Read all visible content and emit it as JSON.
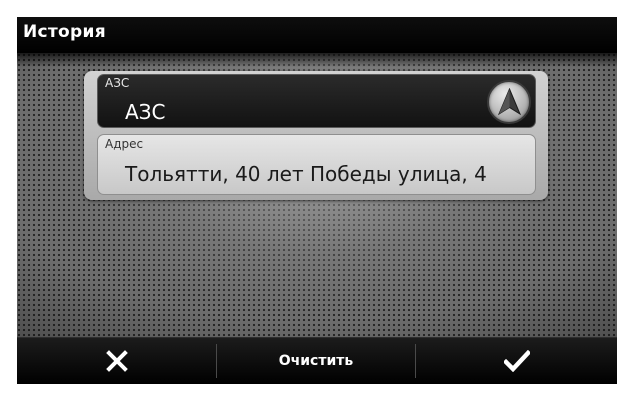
{
  "header": {
    "title": "История"
  },
  "name_field": {
    "label": "АЗС",
    "value": "АЗС"
  },
  "address_field": {
    "label": "Адрес",
    "value": "Тольятти, 40 лет Победы улица, 4"
  },
  "navigate_button": {
    "icon": "navigation-arrow-icon"
  },
  "footer": {
    "cancel_icon": "close-icon",
    "clear_label": "Очистить",
    "confirm_icon": "checkmark-icon"
  },
  "colors": {
    "titlebar_bg": "#000000",
    "title_text": "#ffffff",
    "name_field_bg": "#1a1a1a",
    "address_field_bg": "#d9d9d9"
  }
}
